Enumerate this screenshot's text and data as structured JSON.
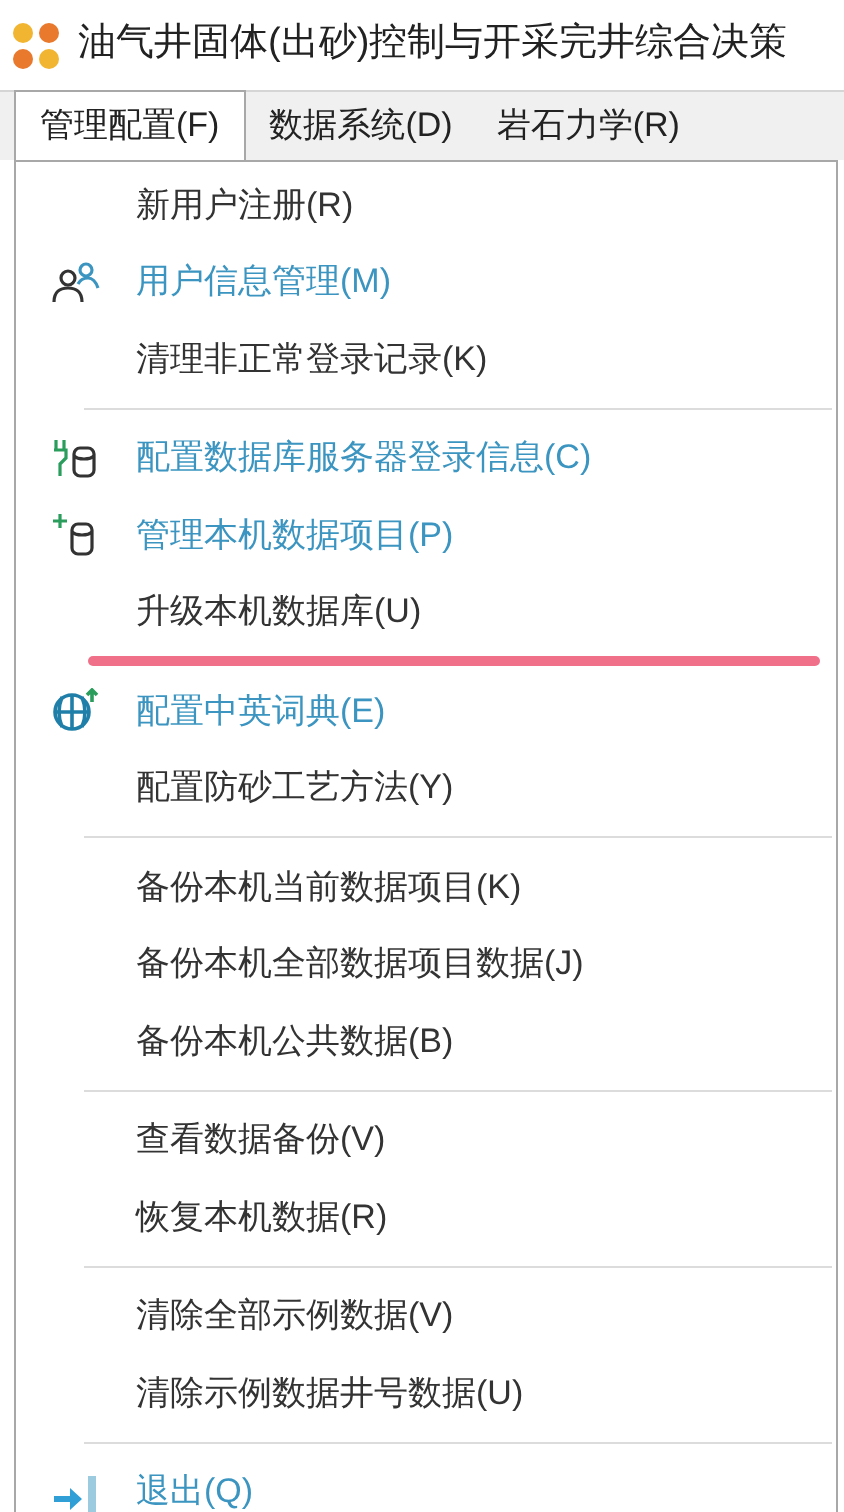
{
  "window": {
    "title": "油气井固体(出砂)控制与开采完井综合决策"
  },
  "menubar": [
    {
      "label": "管理配置(F)",
      "selected": true
    },
    {
      "label": "数据系统(D)",
      "selected": false
    },
    {
      "label": "岩石力学(R)",
      "selected": false
    }
  ],
  "menu": {
    "groups": [
      [
        {
          "label": "新用户注册(R)",
          "kind": "plain",
          "marked": false
        },
        {
          "label": "用户信息管理(M)",
          "kind": "users",
          "marked": false
        },
        {
          "label": "清理非正常登录记录(K)",
          "kind": "plain",
          "marked": false
        }
      ],
      [
        {
          "label": "配置数据库服务器登录信息(C)",
          "kind": "database-link",
          "marked": false
        },
        {
          "label": "管理本机数据项目(P)",
          "kind": "database-add",
          "marked": false
        },
        {
          "label": "升级本机数据库(U)",
          "kind": "plain",
          "marked": true
        },
        {
          "label": "配置中英词典(E)",
          "kind": "globe",
          "marked": false
        },
        {
          "label": "配置防砂工艺方法(Y)",
          "kind": "plain",
          "marked": false
        }
      ],
      [
        {
          "label": "备份本机当前数据项目(K)",
          "kind": "plain",
          "marked": false
        },
        {
          "label": "备份本机全部数据项目数据(J)",
          "kind": "plain",
          "marked": false
        },
        {
          "label": "备份本机公共数据(B)",
          "kind": "plain",
          "marked": false
        }
      ],
      [
        {
          "label": "查看数据备份(V)",
          "kind": "plain",
          "marked": false
        },
        {
          "label": "恢复本机数据(R)",
          "kind": "plain",
          "marked": false
        }
      ],
      [
        {
          "label": "清除全部示例数据(V)",
          "kind": "plain",
          "marked": false
        },
        {
          "label": "清除示例数据井号数据(U)",
          "kind": "plain",
          "marked": false
        }
      ],
      [
        {
          "label": "退出(Q)",
          "kind": "exit",
          "marked": false
        }
      ]
    ]
  }
}
